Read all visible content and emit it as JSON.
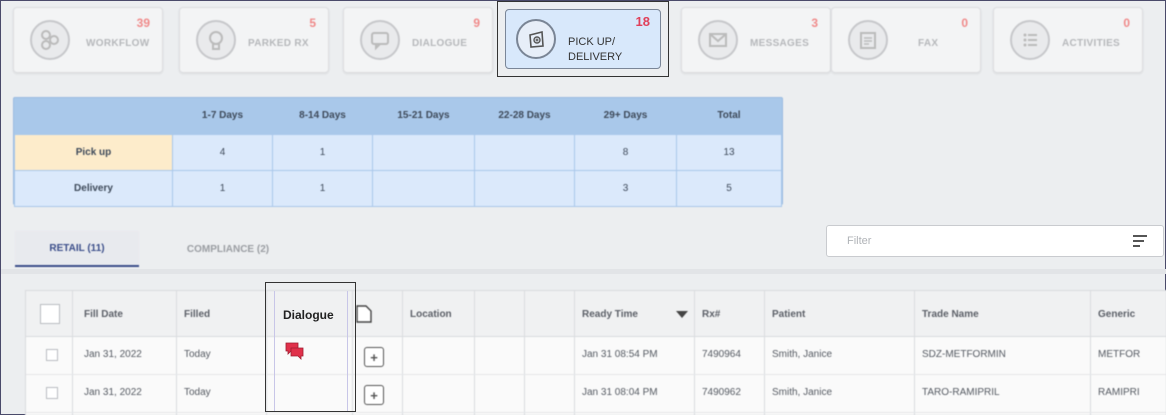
{
  "tiles": [
    {
      "label": "WORKFLOW",
      "count": "39",
      "icon": "workflow-icon"
    },
    {
      "label": "PARKED RX",
      "count": "5",
      "icon": "parked-rx-icon"
    },
    {
      "label": "DIALOGUE",
      "count": "9",
      "icon": "dialogue-icon"
    },
    {
      "label_line1": "PICK UP/",
      "label_line2": "DELIVERY",
      "count": "18",
      "icon": "pickup-bag-icon",
      "active": true
    },
    {
      "label": "MESSAGES",
      "count": "3",
      "icon": "envelope-icon"
    },
    {
      "label": "FAX",
      "count": "0",
      "icon": "fax-icon"
    },
    {
      "label": "ACTIVITIES",
      "count": "0",
      "icon": "activities-list-icon"
    }
  ],
  "summary": {
    "headers": [
      "",
      "1-7 Days",
      "8-14 Days",
      "15-21 Days",
      "22-28 Days",
      "29+ Days",
      "Total"
    ],
    "rows": [
      {
        "label": "Pick up",
        "values": [
          "4",
          "1",
          "",
          "",
          "8",
          "13"
        ]
      },
      {
        "label": "Delivery",
        "values": [
          "1",
          "1",
          "",
          "",
          "3",
          "5"
        ]
      }
    ]
  },
  "tabs": [
    {
      "label": "RETAIL (11)",
      "active": true
    },
    {
      "label": "COMPLIANCE (2)",
      "active": false
    }
  ],
  "filter": {
    "placeholder": "Filter"
  },
  "grid": {
    "headers": {
      "fill_date": "Fill Date",
      "filled": "Filled",
      "dialogue": "Dialogue",
      "location": "Location",
      "ready_time": "Ready Time",
      "rx": "Rx#",
      "patient": "Patient",
      "trade_name": "Trade Name",
      "generic": "Generic"
    },
    "rows": [
      {
        "fill_date": "Jan 31, 2022",
        "filled": "Today",
        "has_dialogue": true,
        "ready_time": "Jan 31 08:54 PM",
        "rx": "7490964",
        "patient": "Smith, Janice",
        "trade_name": "SDZ-METFORMIN",
        "generic": "METFOR"
      },
      {
        "fill_date": "Jan 31, 2022",
        "filled": "Today",
        "has_dialogue": false,
        "ready_time": "Jan 31 08:04 PM",
        "rx": "7490962",
        "patient": "Smith, Janice",
        "trade_name": "TARO-RAMIPRIL",
        "generic": "RAMIPRI"
      }
    ]
  },
  "colors": {
    "accent": "#3b4e8a",
    "count_red": "#e0405a",
    "summary_blue": "#a9c8ea",
    "pickup_row": "#fdeccb"
  }
}
